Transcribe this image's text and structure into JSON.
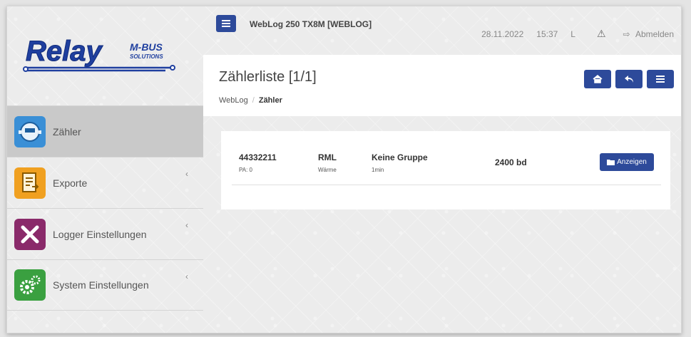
{
  "sidebar": {
    "logo": {
      "brand": "Relay",
      "tagline_top": "M-BUS",
      "tagline_bottom": "SOLUTIONS"
    },
    "items": [
      {
        "label": "Zähler",
        "icon": "meter-icon",
        "color": "#3a8fd6",
        "active": true
      },
      {
        "label": "Exporte",
        "icon": "export-icon",
        "color": "#f0a020",
        "chevron": "‹"
      },
      {
        "label": "Logger Einstellungen",
        "icon": "tools-icon",
        "color": "#8a2a6a",
        "chevron": "‹"
      },
      {
        "label": "System Einstellungen",
        "icon": "gears-icon",
        "color": "#3aa040",
        "chevron": "‹"
      }
    ]
  },
  "topbar": {
    "device_name": "WebLog 250 TX8M [WEBLOG]",
    "date": "28.11.2022",
    "time": "15:37",
    "user": "L",
    "logout": "Abmelden"
  },
  "page": {
    "title": "Zählerliste [1/1]",
    "breadcrumb": [
      "WebLog",
      "Zähler"
    ]
  },
  "meters": [
    {
      "id": "44332211",
      "pa": "PA: 0",
      "manufacturer": "RML",
      "medium": "Wärme",
      "group": "Keine Gruppe",
      "interval": "1min",
      "baud": "2400 bd",
      "action": "Anzeigen"
    }
  ],
  "colors": {
    "accent": "#2d4a9a",
    "active_bg": "#c9c9c9"
  }
}
